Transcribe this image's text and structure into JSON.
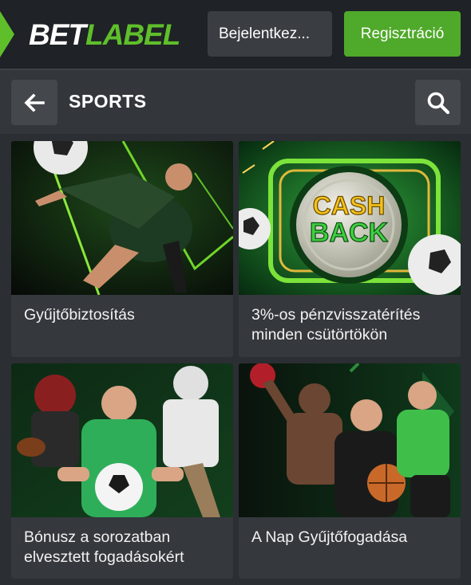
{
  "header": {
    "logo_part1": "BET",
    "logo_part2": "LABEL",
    "login_label": "Bejelentkez...",
    "register_label": "Regisztráció",
    "colors": {
      "brand_green": "#5fbf2b",
      "register_green": "#4fa92a",
      "bar_bg": "#1f2226"
    }
  },
  "section": {
    "back_icon": "arrow-left-icon",
    "title": "SPORTS",
    "search_icon": "search-icon"
  },
  "promotions": [
    {
      "caption": "Gyűjtőbiztosítás",
      "image": "soccer-player-kick-image"
    },
    {
      "caption": "3%-os pénzvisszatérítés minden csütörtökön",
      "image": "cashback-coin-image",
      "image_text_1": "CASH",
      "image_text_2": "BACK"
    },
    {
      "caption": "Bónusz a sorozatban elvesztett fogadásokért",
      "image": "multi-sport-athletes-image"
    },
    {
      "caption": "A Nap Gyűjtőfogadása",
      "image": "boxer-basketball-athletes-image"
    }
  ]
}
